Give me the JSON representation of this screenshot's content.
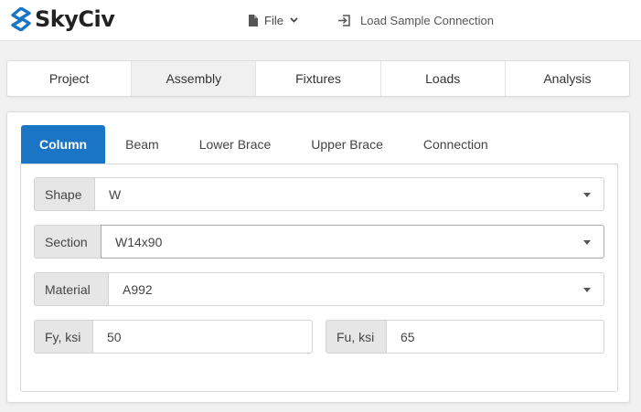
{
  "brand": {
    "name": "SkyCiv"
  },
  "topbar": {
    "file_label": "File",
    "load_sample_label": "Load Sample Connection"
  },
  "main_tabs": [
    {
      "label": "Project",
      "active": false
    },
    {
      "label": "Assembly",
      "active": true
    },
    {
      "label": "Fixtures",
      "active": false
    },
    {
      "label": "Loads",
      "active": false
    },
    {
      "label": "Analysis",
      "active": false
    }
  ],
  "sub_tabs": [
    {
      "label": "Column",
      "active": true
    },
    {
      "label": "Beam",
      "active": false
    },
    {
      "label": "Lower Brace",
      "active": false
    },
    {
      "label": "Upper Brace",
      "active": false
    },
    {
      "label": "Connection",
      "active": false
    }
  ],
  "form": {
    "shape": {
      "label": "Shape",
      "value": "W"
    },
    "section": {
      "label": "Section",
      "value": "W14x90"
    },
    "material": {
      "label": "Material",
      "value": "A992"
    },
    "fy": {
      "label": "Fy, ksi",
      "value": "50"
    },
    "fu": {
      "label": "Fu, ksi",
      "value": "65"
    }
  },
  "colors": {
    "accent": "#1a75c4",
    "brand_blue": "#1a75c4"
  },
  "icons": {
    "file": "file-icon",
    "chevron": "chevron-down-icon",
    "load": "login-icon",
    "dropdown": "caret-down-icon"
  }
}
